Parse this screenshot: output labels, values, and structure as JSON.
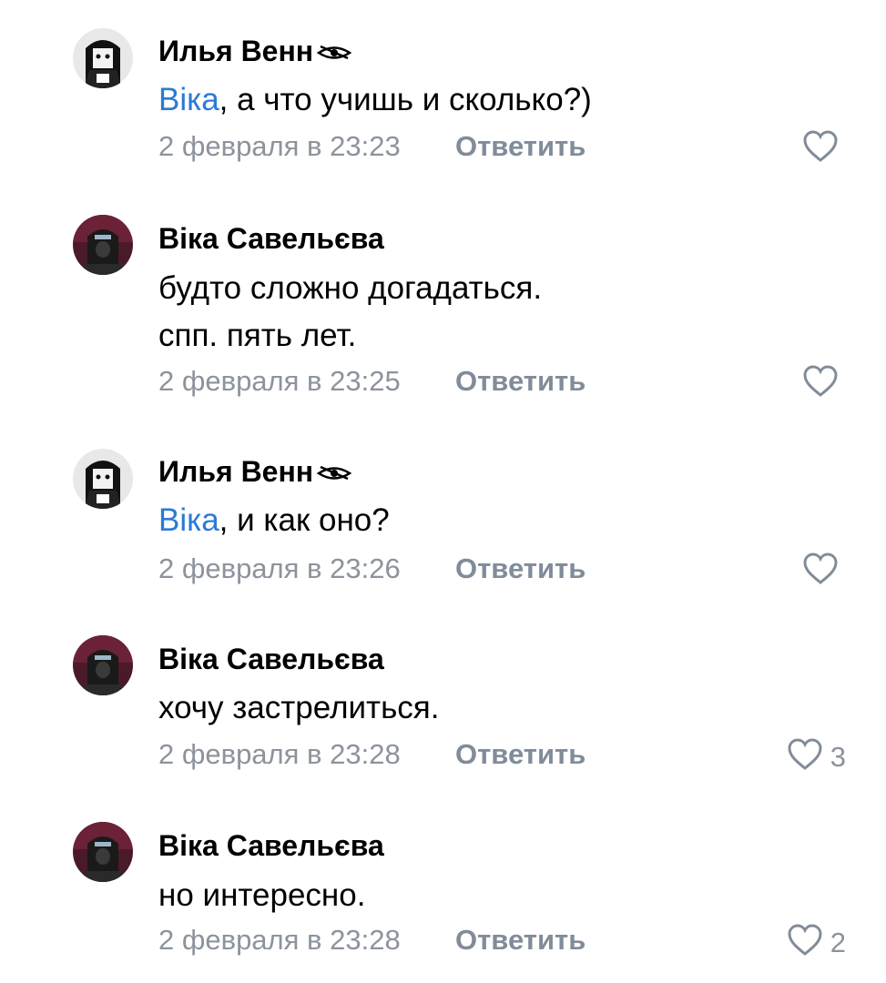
{
  "comments": [
    {
      "author": "Илья Венн",
      "author_badge_icon": "eye-icon",
      "mention": "Віка",
      "text": ", а что учишь и сколько?)",
      "date": "2 февраля в 23:23",
      "reply_label": "Ответить",
      "likes": ""
    },
    {
      "author": "Віка Савельєва",
      "text_line1": "будто сложно догадаться.",
      "text_line2": "спп. пять лет.",
      "date": "2 февраля в 23:25",
      "reply_label": "Ответить",
      "likes": ""
    },
    {
      "author": "Илья Венн",
      "author_badge_icon": "eye-icon",
      "mention": "Віка",
      "text": ", и как оно?",
      "date": "2 февраля в 23:26",
      "reply_label": "Ответить",
      "likes": ""
    },
    {
      "author": "Віка Савельєва",
      "text": "хочу застрелиться.",
      "date": "2 февраля в 23:28",
      "reply_label": "Ответить",
      "likes": "3"
    },
    {
      "author": "Віка Савельєва",
      "text": "но интересно.",
      "date": "2 февраля в 23:28",
      "reply_label": "Ответить",
      "likes": "2"
    }
  ],
  "colors": {
    "mention": "#2a7ad6",
    "meta": "#8c939d",
    "reply": "#818c99"
  }
}
